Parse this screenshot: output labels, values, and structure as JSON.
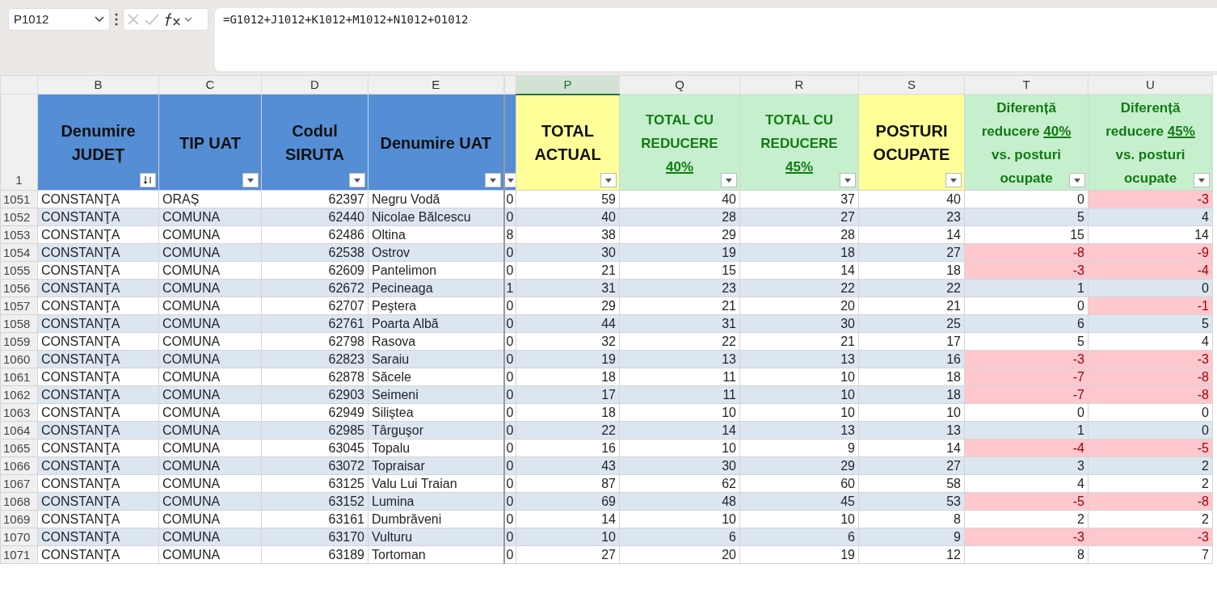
{
  "name_box": {
    "value": "P1012"
  },
  "formula_bar": {
    "value": "=G1012+J1012+K1012+M1012+N1012+O1012"
  },
  "header_row_number": "1",
  "columns": [
    {
      "letter": "B",
      "kind": "blue",
      "numeric": false,
      "selected": false,
      "sorted": true,
      "parts": [
        {
          "text": "Denumire JUDEȚ",
          "underline": false
        }
      ]
    },
    {
      "letter": "C",
      "kind": "blue",
      "numeric": false,
      "selected": false,
      "sorted": false,
      "parts": [
        {
          "text": "TIP UAT",
          "underline": false
        }
      ]
    },
    {
      "letter": "D",
      "kind": "blue",
      "numeric": true,
      "selected": false,
      "sorted": false,
      "parts": [
        {
          "text": "Codul SIRUTA",
          "underline": false
        }
      ]
    },
    {
      "letter": "E",
      "kind": "blue",
      "numeric": false,
      "selected": false,
      "sorted": false,
      "parts": [
        {
          "text": "Denumire UAT",
          "underline": false
        }
      ]
    },
    {
      "kind": "blue",
      "numeric": false,
      "sorted": false
    },
    {
      "letter": "P",
      "kind": "yellow",
      "numeric": true,
      "selected": true,
      "sorted": false,
      "parts": [
        {
          "text": "TOTAL ACTUAL",
          "underline": false
        }
      ]
    },
    {
      "letter": "Q",
      "kind": "green",
      "numeric": true,
      "selected": false,
      "sorted": false,
      "parts": [
        {
          "text": "TOTAL CU REDUCERE",
          "underline": false
        },
        {
          "text": "40%",
          "underline": true
        }
      ]
    },
    {
      "letter": "R",
      "kind": "green",
      "numeric": true,
      "selected": false,
      "sorted": false,
      "parts": [
        {
          "text": "TOTAL CU REDUCERE",
          "underline": false
        },
        {
          "text": "45%",
          "underline": true
        }
      ]
    },
    {
      "letter": "S",
      "kind": "yellow",
      "numeric": true,
      "selected": false,
      "sorted": false,
      "parts": [
        {
          "text": "POSTURI OCUPATE",
          "underline": false
        }
      ]
    },
    {
      "letter": "T",
      "kind": "green",
      "numeric": true,
      "selected": false,
      "sorted": false,
      "parts": [
        {
          "text": "Diferență reducere",
          "underline": false
        },
        {
          "text": "40%",
          "underline": true
        },
        {
          "text": "vs. posturi ocupate",
          "underline": false
        }
      ]
    },
    {
      "letter": "U",
      "kind": "green",
      "numeric": true,
      "selected": false,
      "sorted": false,
      "parts": [
        {
          "text": "Diferență reducere",
          "underline": false
        },
        {
          "text": "45%",
          "underline": true
        },
        {
          "text": "vs. posturi ocupate",
          "underline": false
        }
      ]
    }
  ],
  "rows": [
    {
      "row": "1051",
      "cells": [
        "CONSTANŢA",
        "ORAȘ",
        "62397",
        "Negru Vodă",
        "0",
        "59",
        "40",
        "37",
        "40",
        {
          "value": "0",
          "flagged": false
        },
        {
          "value": "-3",
          "flagged": true
        }
      ]
    },
    {
      "row": "1052",
      "cells": [
        "CONSTANŢA",
        "COMUNA",
        "62440",
        "Nicolae Bălcescu",
        "0",
        "40",
        "28",
        "27",
        "23",
        {
          "value": "5",
          "flagged": false
        },
        {
          "value": "4",
          "flagged": false
        }
      ]
    },
    {
      "row": "1053",
      "cells": [
        "CONSTANŢA",
        "COMUNA",
        "62486",
        "Oltina",
        "8",
        "38",
        "29",
        "28",
        "14",
        {
          "value": "15",
          "flagged": false
        },
        {
          "value": "14",
          "flagged": false
        }
      ]
    },
    {
      "row": "1054",
      "cells": [
        "CONSTANŢA",
        "COMUNA",
        "62538",
        "Ostrov",
        "0",
        "30",
        "19",
        "18",
        "27",
        {
          "value": "-8",
          "flagged": true
        },
        {
          "value": "-9",
          "flagged": true
        }
      ]
    },
    {
      "row": "1055",
      "cells": [
        "CONSTANŢA",
        "COMUNA",
        "62609",
        "Pantelimon",
        "0",
        "21",
        "15",
        "14",
        "18",
        {
          "value": "-3",
          "flagged": true
        },
        {
          "value": "-4",
          "flagged": true
        }
      ]
    },
    {
      "row": "1056",
      "cells": [
        "CONSTANŢA",
        "COMUNA",
        "62672",
        "Pecineaga",
        "1",
        "31",
        "23",
        "22",
        "22",
        {
          "value": "1",
          "flagged": false
        },
        {
          "value": "0",
          "flagged": false
        }
      ]
    },
    {
      "row": "1057",
      "cells": [
        "CONSTANŢA",
        "COMUNA",
        "62707",
        "Peştera",
        "0",
        "29",
        "21",
        "20",
        "21",
        {
          "value": "0",
          "flagged": false
        },
        {
          "value": "-1",
          "flagged": true
        }
      ]
    },
    {
      "row": "1058",
      "cells": [
        "CONSTANŢA",
        "COMUNA",
        "62761",
        "Poarta Albă",
        "0",
        "44",
        "31",
        "30",
        "25",
        {
          "value": "6",
          "flagged": false
        },
        {
          "value": "5",
          "flagged": false
        }
      ]
    },
    {
      "row": "1059",
      "cells": [
        "CONSTANŢA",
        "COMUNA",
        "62798",
        "Rasova",
        "0",
        "32",
        "22",
        "21",
        "17",
        {
          "value": "5",
          "flagged": false
        },
        {
          "value": "4",
          "flagged": false
        }
      ]
    },
    {
      "row": "1060",
      "cells": [
        "CONSTANŢA",
        "COMUNA",
        "62823",
        "Saraiu",
        "0",
        "19",
        "13",
        "13",
        "16",
        {
          "value": "-3",
          "flagged": true
        },
        {
          "value": "-3",
          "flagged": true
        }
      ]
    },
    {
      "row": "1061",
      "cells": [
        "CONSTANŢA",
        "COMUNA",
        "62878",
        "Săcele",
        "0",
        "18",
        "11",
        "10",
        "18",
        {
          "value": "-7",
          "flagged": true
        },
        {
          "value": "-8",
          "flagged": true
        }
      ]
    },
    {
      "row": "1062",
      "cells": [
        "CONSTANŢA",
        "COMUNA",
        "62903",
        "Seimeni",
        "0",
        "17",
        "11",
        "10",
        "18",
        {
          "value": "-7",
          "flagged": true
        },
        {
          "value": "-8",
          "flagged": true
        }
      ]
    },
    {
      "row": "1063",
      "cells": [
        "CONSTANŢA",
        "COMUNA",
        "62949",
        "Siliştea",
        "0",
        "18",
        "10",
        "10",
        "10",
        {
          "value": "0",
          "flagged": false
        },
        {
          "value": "0",
          "flagged": false
        }
      ]
    },
    {
      "row": "1064",
      "cells": [
        "CONSTANŢA",
        "COMUNA",
        "62985",
        "Târguşor",
        "0",
        "22",
        "14",
        "13",
        "13",
        {
          "value": "1",
          "flagged": false
        },
        {
          "value": "0",
          "flagged": false
        }
      ]
    },
    {
      "row": "1065",
      "cells": [
        "CONSTANŢA",
        "COMUNA",
        "63045",
        "Topalu",
        "0",
        "16",
        "10",
        "9",
        "14",
        {
          "value": "-4",
          "flagged": true
        },
        {
          "value": "-5",
          "flagged": true
        }
      ]
    },
    {
      "row": "1066",
      "cells": [
        "CONSTANŢA",
        "COMUNA",
        "63072",
        "Topraisar",
        "0",
        "43",
        "30",
        "29",
        "27",
        {
          "value": "3",
          "flagged": false
        },
        {
          "value": "2",
          "flagged": false
        }
      ]
    },
    {
      "row": "1067",
      "cells": [
        "CONSTANŢA",
        "COMUNA",
        "63125",
        "Valu Lui Traian",
        "0",
        "87",
        "62",
        "60",
        "58",
        {
          "value": "4",
          "flagged": false
        },
        {
          "value": "2",
          "flagged": false
        }
      ]
    },
    {
      "row": "1068",
      "cells": [
        "CONSTANŢA",
        "COMUNA",
        "63152",
        "Lumina",
        "0",
        "69",
        "48",
        "45",
        "53",
        {
          "value": "-5",
          "flagged": true
        },
        {
          "value": "-8",
          "flagged": true
        }
      ]
    },
    {
      "row": "1069",
      "cells": [
        "CONSTANŢA",
        "COMUNA",
        "63161",
        "Dumbrăveni",
        "0",
        "14",
        "10",
        "10",
        "8",
        {
          "value": "2",
          "flagged": false
        },
        {
          "value": "2",
          "flagged": false
        }
      ]
    },
    {
      "row": "1070",
      "cells": [
        "CONSTANŢA",
        "COMUNA",
        "63170",
        "Vulturu",
        "0",
        "10",
        "6",
        "6",
        "9",
        {
          "value": "-3",
          "flagged": true
        },
        {
          "value": "-3",
          "flagged": true
        }
      ]
    },
    {
      "row": "1071",
      "cells": [
        "CONSTANŢA",
        "COMUNA",
        "63189",
        "Tortoman",
        "0",
        "27",
        "20",
        "19",
        "12",
        {
          "value": "8",
          "flagged": false
        },
        {
          "value": "7",
          "flagged": false
        }
      ]
    }
  ]
}
